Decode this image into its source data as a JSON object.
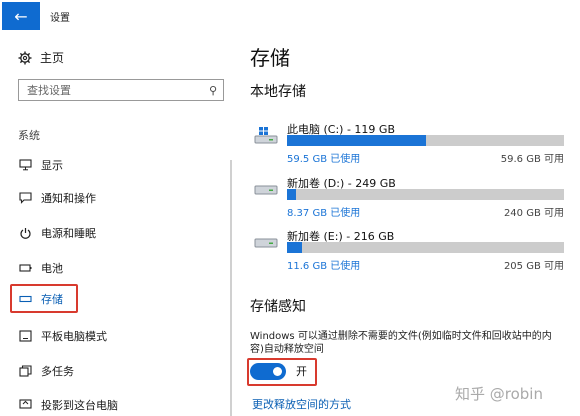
{
  "window": {
    "title": "设置",
    "back_icon": "back-arrow-icon"
  },
  "sidebar": {
    "home_label": "主页",
    "search_placeholder": "查找设置",
    "section_label": "系统",
    "items": [
      {
        "label": "显示",
        "icon": "monitor-icon"
      },
      {
        "label": "通知和操作",
        "icon": "notification-icon"
      },
      {
        "label": "电源和睡眠",
        "icon": "power-icon"
      },
      {
        "label": "电池",
        "icon": "battery-icon"
      },
      {
        "label": "存储",
        "icon": "storage-icon",
        "active": true
      },
      {
        "label": "平板电脑模式",
        "icon": "tablet-icon"
      },
      {
        "label": "多任务",
        "icon": "multitask-icon"
      },
      {
        "label": "投影到这台电脑",
        "icon": "project-icon"
      }
    ]
  },
  "main": {
    "title": "存储",
    "local_storage_title": "本地存储",
    "drives": [
      {
        "name": "此电脑 (C:) - 119 GB",
        "used": "59.5 GB 已使用",
        "available": "59.6 GB 可用",
        "used_fraction": 0.5,
        "icon": "windows-drive-icon"
      },
      {
        "name": "新加卷 (D:) - 249 GB",
        "used": "8.37 GB 已使用",
        "available": "240 GB 可用",
        "used_fraction": 0.034,
        "icon": "drive-icon"
      },
      {
        "name": "新加卷 (E:) - 216 GB",
        "used": "11.6 GB 已使用",
        "available": "205 GB 可用",
        "used_fraction": 0.054,
        "icon": "drive-icon"
      }
    ],
    "storage_sense": {
      "title": "存储感知",
      "description": "Windows 可以通过删除不需要的文件(例如临时文件和回收站中的内容)自动释放空间",
      "toggle_label": "开",
      "toggle_on": true,
      "link": "更改释放空间的方式"
    }
  },
  "watermark": "知乎 @robin",
  "colors": {
    "accent": "#0f6bd0",
    "highlight_box": "#d83a2e",
    "bar_bg": "#cccccc"
  }
}
